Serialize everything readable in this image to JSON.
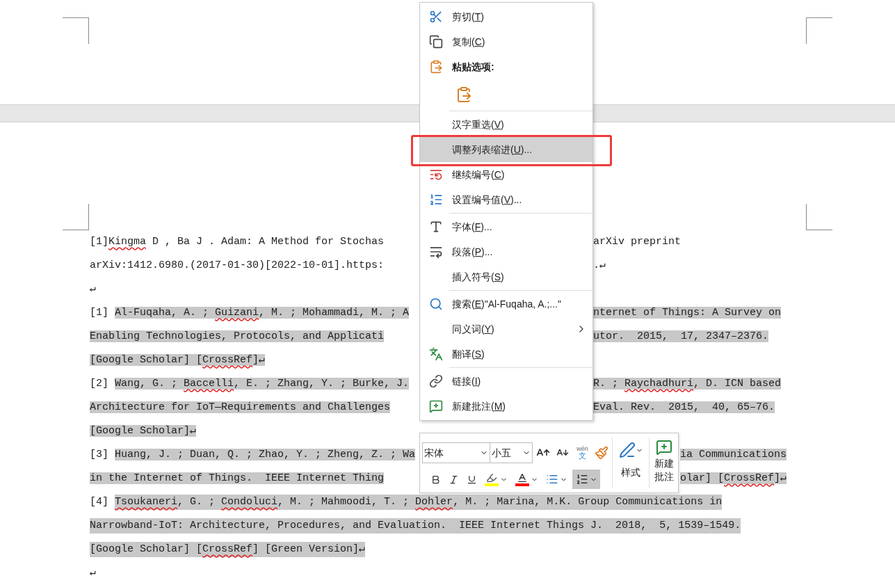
{
  "document": {
    "menu_rows": [
      {
        "left": [
          {
            "text": "[1]",
            "highlighted": false,
            "misspelled": false
          },
          {
            "text": "Kingma",
            "highlighted": false,
            "misspelled": true
          },
          {
            "text": " D , Ba J . Adam: A Method for Stochas",
            "highlighted": false,
            "misspelled": false
          }
        ],
        "right": [
          {
            "text": "arXiv preprint",
            "highlighted": false,
            "misspelled": false
          }
        ]
      },
      {
        "left": [
          {
            "text": "arXiv:1412.6980.(2017-01-30)[2022-10-01].https:",
            "highlighted": false,
            "misspelled": false
          }
        ],
        "right": [
          {
            "text": ".↵",
            "highlighted": false,
            "misspelled": false
          }
        ]
      },
      {
        "left": [
          {
            "text": "↵",
            "highlighted": false,
            "misspelled": false
          }
        ],
        "right": []
      },
      {
        "left": [
          {
            "text": "[1] ",
            "highlighted": false,
            "misspelled": false
          },
          {
            "text": "Al-Fuqaha, A. ; ",
            "highlighted": true,
            "misspelled": false
          },
          {
            "text": "Guizani",
            "highlighted": true,
            "misspelled": true
          },
          {
            "text": ", M. ; Mohammadi, M. ; A",
            "highlighted": true,
            "misspelled": false
          }
        ],
        "right": [
          {
            "text": "nternet of Things: A Survey on",
            "highlighted": true,
            "misspelled": false
          }
        ]
      },
      {
        "left": [
          {
            "text": "Enabling Technologies, Protocols, and Applicati",
            "highlighted": true,
            "misspelled": false
          }
        ],
        "right": [
          {
            "text": "utor.  2015,  17, 2347–2376.",
            "highlighted": true,
            "misspelled": false
          }
        ]
      },
      {
        "left": [
          {
            "text": "[Google Scholar] [",
            "highlighted": true,
            "misspelled": false
          },
          {
            "text": "CrossRef",
            "highlighted": true,
            "misspelled": true
          },
          {
            "text": "]↵",
            "highlighted": true,
            "misspelled": false
          }
        ],
        "right": []
      },
      {
        "left": [
          {
            "text": "[2] ",
            "highlighted": false,
            "misspelled": false
          },
          {
            "text": "Wang, G. ; ",
            "highlighted": true,
            "misspelled": false
          },
          {
            "text": "Baccelli",
            "highlighted": true,
            "misspelled": true
          },
          {
            "text": ", E. ; Zhang, Y. ; Burke, J.",
            "highlighted": true,
            "misspelled": false
          }
        ],
        "right": [
          {
            "text": "R. ; ",
            "highlighted": true,
            "misspelled": false
          },
          {
            "text": "Raychadhuri",
            "highlighted": true,
            "misspelled": true
          },
          {
            "text": ", D. ICN based",
            "highlighted": true,
            "misspelled": false
          }
        ]
      },
      {
        "left": [
          {
            "text": "Architecture for IoT—Requirements and Challenges",
            "highlighted": true,
            "misspelled": false
          }
        ],
        "right": [
          {
            "text": "Eval. Rev.  2015,  40, 65–76.",
            "highlighted": true,
            "misspelled": false
          }
        ]
      },
      {
        "left": [
          {
            "text": "[Google Scholar]↵",
            "highlighted": true,
            "misspelled": false
          }
        ],
        "right": []
      }
    ],
    "toolbar_rows": [
      {
        "left": [
          {
            "text": "[3] ",
            "highlighted": false,
            "misspelled": false
          },
          {
            "text": "Huang, J. ; Duan, Q. ; Zhao, Y. ; Zheng, Z. ; Wa",
            "highlighted": true,
            "misspelled": false
          }
        ],
        "right": [
          {
            "text": "ia Communications",
            "highlighted": true,
            "misspelled": false
          }
        ]
      },
      {
        "left": [
          {
            "text": "in the Internet of Things.  IEEE Internet Thing",
            "highlighted": true,
            "misspelled": false
          }
        ],
        "right": [
          {
            "text": "olar] [",
            "highlighted": true,
            "misspelled": false
          },
          {
            "text": "CrossRef",
            "highlighted": true,
            "misspelled": true
          },
          {
            "text": "]↵",
            "highlighted": true,
            "misspelled": false
          }
        ]
      }
    ],
    "full_rows": [
      {
        "segments": [
          {
            "text": "[4] ",
            "highlighted": false,
            "misspelled": false
          },
          {
            "text": "Tsoukaneri",
            "highlighted": true,
            "misspelled": true
          },
          {
            "text": ", G. ; ",
            "highlighted": true,
            "misspelled": false
          },
          {
            "text": "Condoluci",
            "highlighted": true,
            "misspelled": true
          },
          {
            "text": ", M. ; Mahmoodi, T. ; ",
            "highlighted": true,
            "misspelled": false
          },
          {
            "text": "Dohler",
            "highlighted": true,
            "misspelled": true
          },
          {
            "text": ", M. ; Marina, M.K. Group Communications in",
            "highlighted": true,
            "misspelled": false
          }
        ]
      },
      {
        "segments": [
          {
            "text": "Narrowband-IoT: Architecture, Procedures, and Evaluation.  IEEE Internet Things J.  2018,  5, 1539–1549.",
            "highlighted": true,
            "misspelled": false
          }
        ]
      },
      {
        "segments": [
          {
            "text": "[Google Scholar] [",
            "highlighted": true,
            "misspelled": false
          },
          {
            "text": "CrossRef",
            "highlighted": true,
            "misspelled": true
          },
          {
            "text": "] [Green Version]↵",
            "highlighted": true,
            "misspelled": false
          }
        ]
      },
      {
        "segments": [
          {
            "text": "↵",
            "highlighted": false,
            "misspelled": false
          }
        ]
      }
    ]
  },
  "context_menu": {
    "items": [
      {
        "kind": "command",
        "before": "剪切(",
        "key": "T",
        "after": ")",
        "selected": false,
        "submenu": false
      },
      {
        "kind": "command",
        "before": "复制(",
        "key": "C",
        "after": ")",
        "selected": false,
        "submenu": false
      },
      {
        "kind": "header",
        "text": "粘贴选项:"
      },
      {
        "kind": "paste-options"
      },
      {
        "kind": "separator"
      },
      {
        "kind": "command",
        "before": "汉字重选(",
        "key": "V",
        "after": ")",
        "selected": false,
        "submenu": false
      },
      {
        "kind": "command",
        "before": "调整列表缩进(",
        "key": "U",
        "after": ")...",
        "selected": true,
        "submenu": false
      },
      {
        "kind": "command",
        "before": "继续编号(",
        "key": "C",
        "after": ")",
        "selected": false,
        "submenu": false
      },
      {
        "kind": "command",
        "before": "设置编号值(",
        "key": "V",
        "after": ")...",
        "selected": false,
        "submenu": false
      },
      {
        "kind": "separator"
      },
      {
        "kind": "command",
        "before": "字体(",
        "key": "F",
        "after": ")...",
        "selected": false,
        "submenu": false
      },
      {
        "kind": "command",
        "before": "段落(",
        "key": "P",
        "after": ")...",
        "selected": false,
        "submenu": false
      },
      {
        "kind": "command",
        "before": "插入符号(",
        "key": "S",
        "after": ")",
        "selected": false,
        "submenu": false
      },
      {
        "kind": "separator"
      },
      {
        "kind": "command",
        "before": "搜索(",
        "key": "E",
        "after": ")\"Al-Fuqaha, A.;...\"",
        "selected": false,
        "submenu": false
      },
      {
        "kind": "command",
        "before": "同义词(",
        "key": "Y",
        "after": ")",
        "selected": false,
        "submenu": true
      },
      {
        "kind": "command",
        "before": "翻译(",
        "key": "S",
        "after": ")",
        "selected": false,
        "submenu": false
      },
      {
        "kind": "separator"
      },
      {
        "kind": "command",
        "before": "链接(",
        "key": "I",
        "after": ")",
        "selected": false,
        "submenu": false
      },
      {
        "kind": "command",
        "before": "新建批注(",
        "key": "M",
        "after": ")",
        "selected": false,
        "submenu": false
      }
    ]
  },
  "mini_toolbar": {
    "font": "宋体",
    "size": "小五",
    "phonetic_guide": [
      "wén",
      "文"
    ],
    "bullets_selected": false,
    "numbering_selected": true,
    "styles_label": "样式",
    "new_comment_label": "新建批注"
  }
}
